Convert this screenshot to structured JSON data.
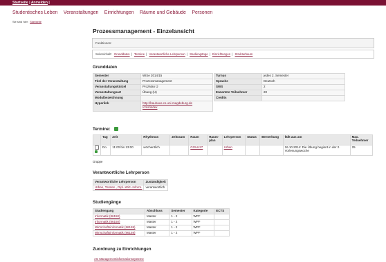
{
  "topbar": {
    "startseite": "Startseite",
    "sep": "|",
    "anmelden": "Anmelden",
    "sep2": "|"
  },
  "nav": [
    "Studentisches Leben",
    "Veranstaltungen",
    "Einrichtungen",
    "Räume und Gebäude",
    "Personen"
  ],
  "crumb": {
    "prefix": "Sie sind hier:",
    "link": "Startseite"
  },
  "page": {
    "title": "Prozessmanagement - Einzelansicht",
    "funktionen": "Funktionen:"
  },
  "sub": {
    "label": "Seiteninhalt:",
    "items": [
      "Grunddaten",
      "Termine",
      "Verantwortliche Lehrperson",
      "Studiengänge",
      "Einrichtungen",
      "Strukturbaum"
    ]
  },
  "grunddaten": {
    "heading": "Grunddaten",
    "left": [
      [
        "Semester",
        "WiSe 2014/15"
      ],
      [
        "Titel der Veranstaltung",
        "Prozessmanagement"
      ],
      [
        "Veranstaltungskürzel",
        "ProzMan Ü"
      ],
      [
        "Veranstaltungsart",
        "Übung (U)"
      ],
      [
        "Modulbezeichnung",
        ""
      ],
      [
        "Hyperlink",
        "http://bauhaus.cs.uni-magdeburg.de\n/cms/index"
      ]
    ],
    "right": [
      [
        "Turnus",
        "jedes 2. Semester"
      ],
      [
        "Sprache",
        "Deutsch"
      ],
      [
        "SWS",
        "2"
      ],
      [
        "Erwartete Teilnehmer",
        "20"
      ],
      [
        "Credits",
        ""
      ]
    ]
  },
  "termine": {
    "heading": "Termine:",
    "cols": [
      "",
      "Tag",
      "Zeit",
      "Rhythmus",
      "Zeitraum",
      "Raum",
      "Raum-\nplan",
      "Lehrperson",
      "Status",
      "Bemerkung",
      "fällt aus am",
      "Max.\nTeilnehmer"
    ],
    "row": {
      "tag": "Do.",
      "zeit": "11:00 bis 13:00",
      "rhythmus": "wöchentlich",
      "zeitraum": "",
      "raum": "G29-K27",
      "raumplan": "",
      "lehrperson": "Urban",
      "status": "",
      "bemerkung": "",
      "faellt": "16.10.2014: Die Übung beginnt in der 2. Vorlesungswoche",
      "max": "25"
    },
    "gruppe": "Gruppe"
  },
  "lehrperson": {
    "heading": "Verantwortliche Lehrperson",
    "cols": [
      "Verantwortliche Lehrperson",
      "Zuständigkeit"
    ],
    "name": "Urban, Torsten , Dipl.-Wirt.-Inform.",
    "role": "verantwortlich"
  },
  "studiengaenge": {
    "heading": "Studiengänge",
    "cols": [
      "Studiengang",
      "Abschluss",
      "Semester",
      "Kategorie",
      "ECTS"
    ],
    "rows": [
      [
        "Informatik (86150)",
        "Master",
        "1 - 2",
        "WPF",
        ""
      ],
      [
        "Informatik (86150)",
        "Master",
        "1 - 2",
        "WPF",
        ""
      ],
      [
        "Wirtschaftsinformatik (86159)",
        "Master",
        "1 - 2",
        "WPF",
        ""
      ],
      [
        "Wirtschaftsinformatik (86159)",
        "Master",
        "1 - 2",
        "WPF",
        ""
      ]
    ]
  },
  "einrichtungen": {
    "heading": "Zuordnung zu Einrichtungen",
    "item": "AG Managementinformationssysteme"
  },
  "colors": {
    "brand": "#7a1033",
    "link": "#8b1a3a"
  }
}
